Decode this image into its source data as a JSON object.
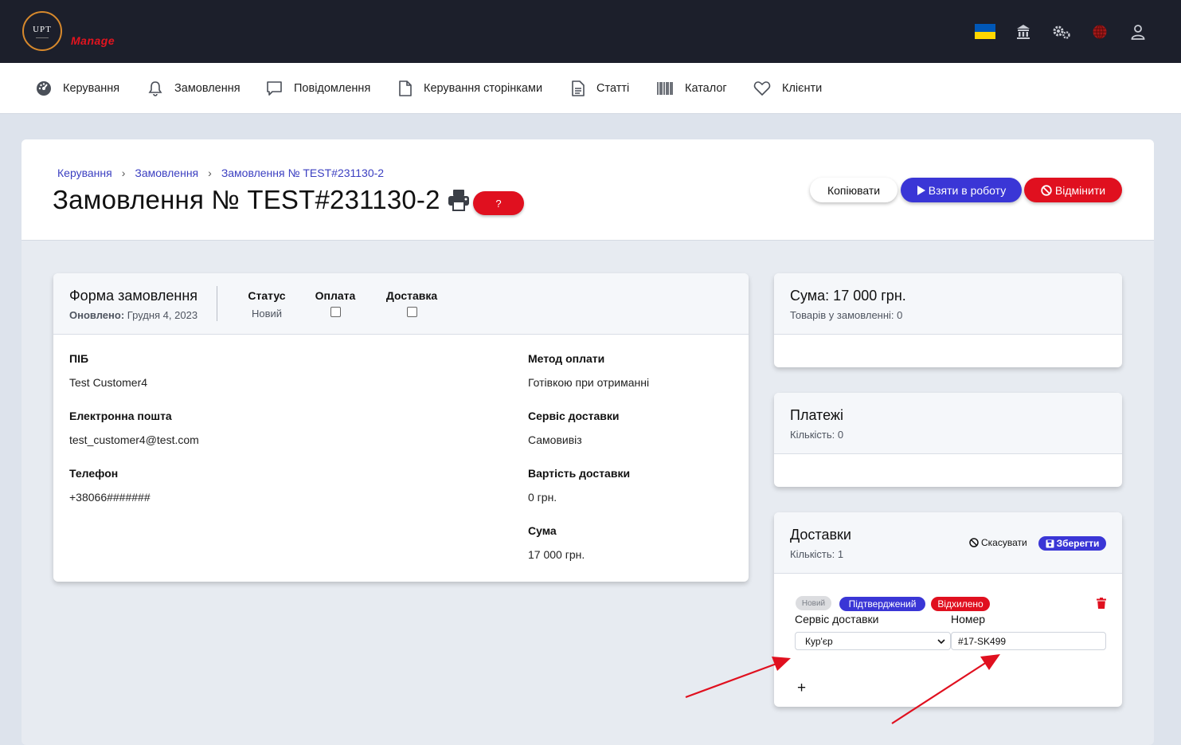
{
  "header": {
    "logo_text": "UPT",
    "brand": "Manage",
    "icons": [
      "ukraine-flag-icon",
      "bank-icon",
      "gears-icon",
      "globe-icon",
      "user-icon"
    ]
  },
  "nav": [
    {
      "label": "Керування",
      "icon": "dashboard-icon"
    },
    {
      "label": "Замовлення",
      "icon": "bell-icon"
    },
    {
      "label": "Повідомлення",
      "icon": "message-icon"
    },
    {
      "label": "Керування сторінками",
      "icon": "file-icon"
    },
    {
      "label": "Статті",
      "icon": "article-icon"
    },
    {
      "label": "Каталог",
      "icon": "barcode-icon"
    },
    {
      "label": "Клієнти",
      "icon": "heart-icon"
    }
  ],
  "breadcrumb": [
    "Керування",
    "Замовлення",
    "Замовлення № TEST#231130-2"
  ],
  "title": "Замовлення № TEST#231130-2",
  "help_label": "?",
  "actions": {
    "copy": "Копіювати",
    "work": "Взяти в роботу",
    "cancel": "Відмінити"
  },
  "order_form": {
    "title": "Форма замовлення",
    "updated_label": "Оновлено:",
    "updated_value": "Грудня 4, 2023",
    "status_label": "Статус",
    "status_value": "Новий",
    "payment_label": "Оплата",
    "delivery_label": "Доставка",
    "fields_left": [
      {
        "label": "ПІБ",
        "value": "Test Customer4"
      },
      {
        "label": "Електронна пошта",
        "value": "test_customer4@test.com"
      },
      {
        "label": "Телефон",
        "value": "+38066#######"
      }
    ],
    "fields_right": [
      {
        "label": "Метод оплати",
        "value": "Готівкою при отриманні"
      },
      {
        "label": "Сервіс доставки",
        "value": "Самовивіз"
      },
      {
        "label": "Вартість доставки",
        "value": "0 грн."
      },
      {
        "label": "Сума",
        "value": "17 000 грн."
      }
    ]
  },
  "sum_card": {
    "title": "Сума: 17 000 грн.",
    "subtitle": "Товарів у замовленні: 0"
  },
  "payments_card": {
    "title": "Платежі",
    "subtitle": "Кількість: 0"
  },
  "deliveries_card": {
    "title": "Доставки",
    "subtitle": "Кількість: 1",
    "cancel_label": "Скасувати",
    "save_label": "Зберегти",
    "badges": {
      "new": "Новий",
      "confirmed": "Підтверджений",
      "rejected": "Відхилено"
    },
    "service_label": "Сервіс доставки",
    "number_label": "Номер",
    "service_value": "Кур'єр",
    "number_value": "#17-SK499",
    "add_label": "+"
  },
  "colors": {
    "accent": "#3a36d6",
    "danger": "#e0101f",
    "dark": "#1c1f2b",
    "link": "#3b3fc1"
  }
}
